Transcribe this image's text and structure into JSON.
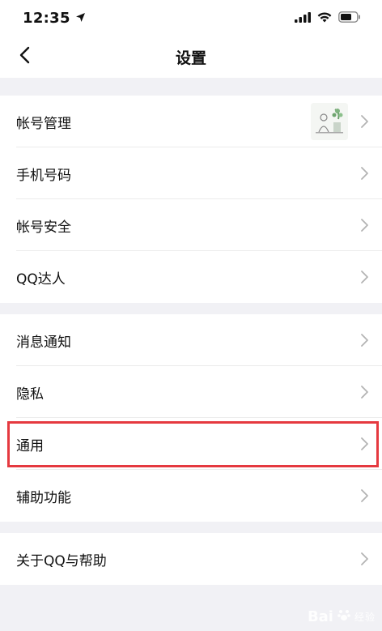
{
  "status_bar": {
    "time": "12:35",
    "icons": [
      "location-arrow-icon",
      "signal-icon",
      "wifi-icon",
      "battery-icon"
    ]
  },
  "nav": {
    "title": "设置",
    "back_icon": "chevron-left-icon"
  },
  "groups": [
    {
      "items": [
        {
          "label": "帐号管理",
          "has_avatar": true
        },
        {
          "label": "手机号码"
        },
        {
          "label": "帐号安全"
        },
        {
          "label": "QQ达人"
        }
      ]
    },
    {
      "items": [
        {
          "label": "消息通知"
        },
        {
          "label": "隐私"
        },
        {
          "label": "通用",
          "highlighted": true
        },
        {
          "label": "辅助功能"
        }
      ]
    },
    {
      "items": [
        {
          "label": "关于QQ与帮助"
        }
      ]
    }
  ],
  "highlight_color": "#e5393f",
  "watermark": {
    "brand": "Bai",
    "sub": "经验"
  }
}
